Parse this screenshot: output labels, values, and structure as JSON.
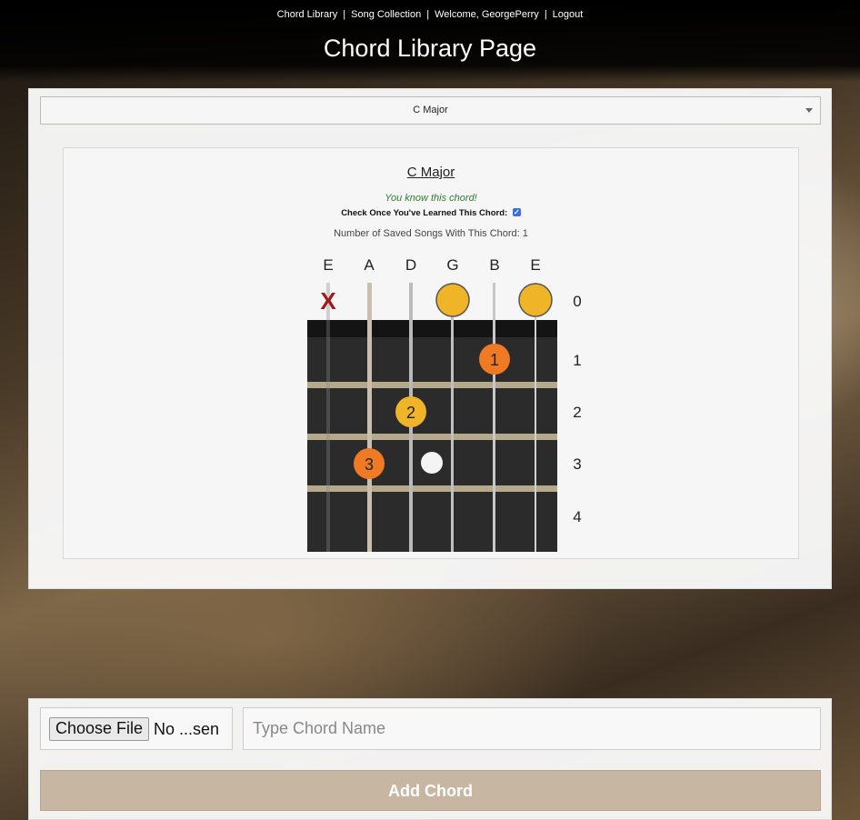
{
  "nav": {
    "items": [
      "Chord Library",
      "Song Collection",
      "Welcome, GeorgePerry",
      "Logout"
    ],
    "separator": "|"
  },
  "page_title": "Chord Library Page",
  "chord_select": {
    "selected": "C Major"
  },
  "chord_card": {
    "name": "C Major",
    "known_message": "You know this chord!",
    "learned_label": "Check Once You've Learned This Chord:",
    "learned_checked": true,
    "saved_songs_label": "Number of Saved Songs With This Chord: 1"
  },
  "fretboard": {
    "strings": [
      "E",
      "A",
      "D",
      "G",
      "B",
      "E"
    ],
    "fret_numbers": [
      "0",
      "1",
      "2",
      "3",
      "4"
    ],
    "muted_marker": "X",
    "open_string_color": "#f0b429",
    "finger_color_orange": "#f07a24",
    "finger_color_yellow": "#f0b429",
    "fingers": [
      {
        "string": "B",
        "fret": 1,
        "label": "1"
      },
      {
        "string": "D",
        "fret": 2,
        "label": "2"
      },
      {
        "string": "A",
        "fret": 3,
        "label": "3"
      }
    ],
    "open_strings": [
      "G",
      "E"
    ],
    "muted_strings": [
      "E"
    ]
  },
  "add_form": {
    "file_button": "Choose File",
    "file_status": "No ...sen",
    "chord_name_placeholder": "Type Chord Name",
    "submit_label": "Add Chord"
  }
}
